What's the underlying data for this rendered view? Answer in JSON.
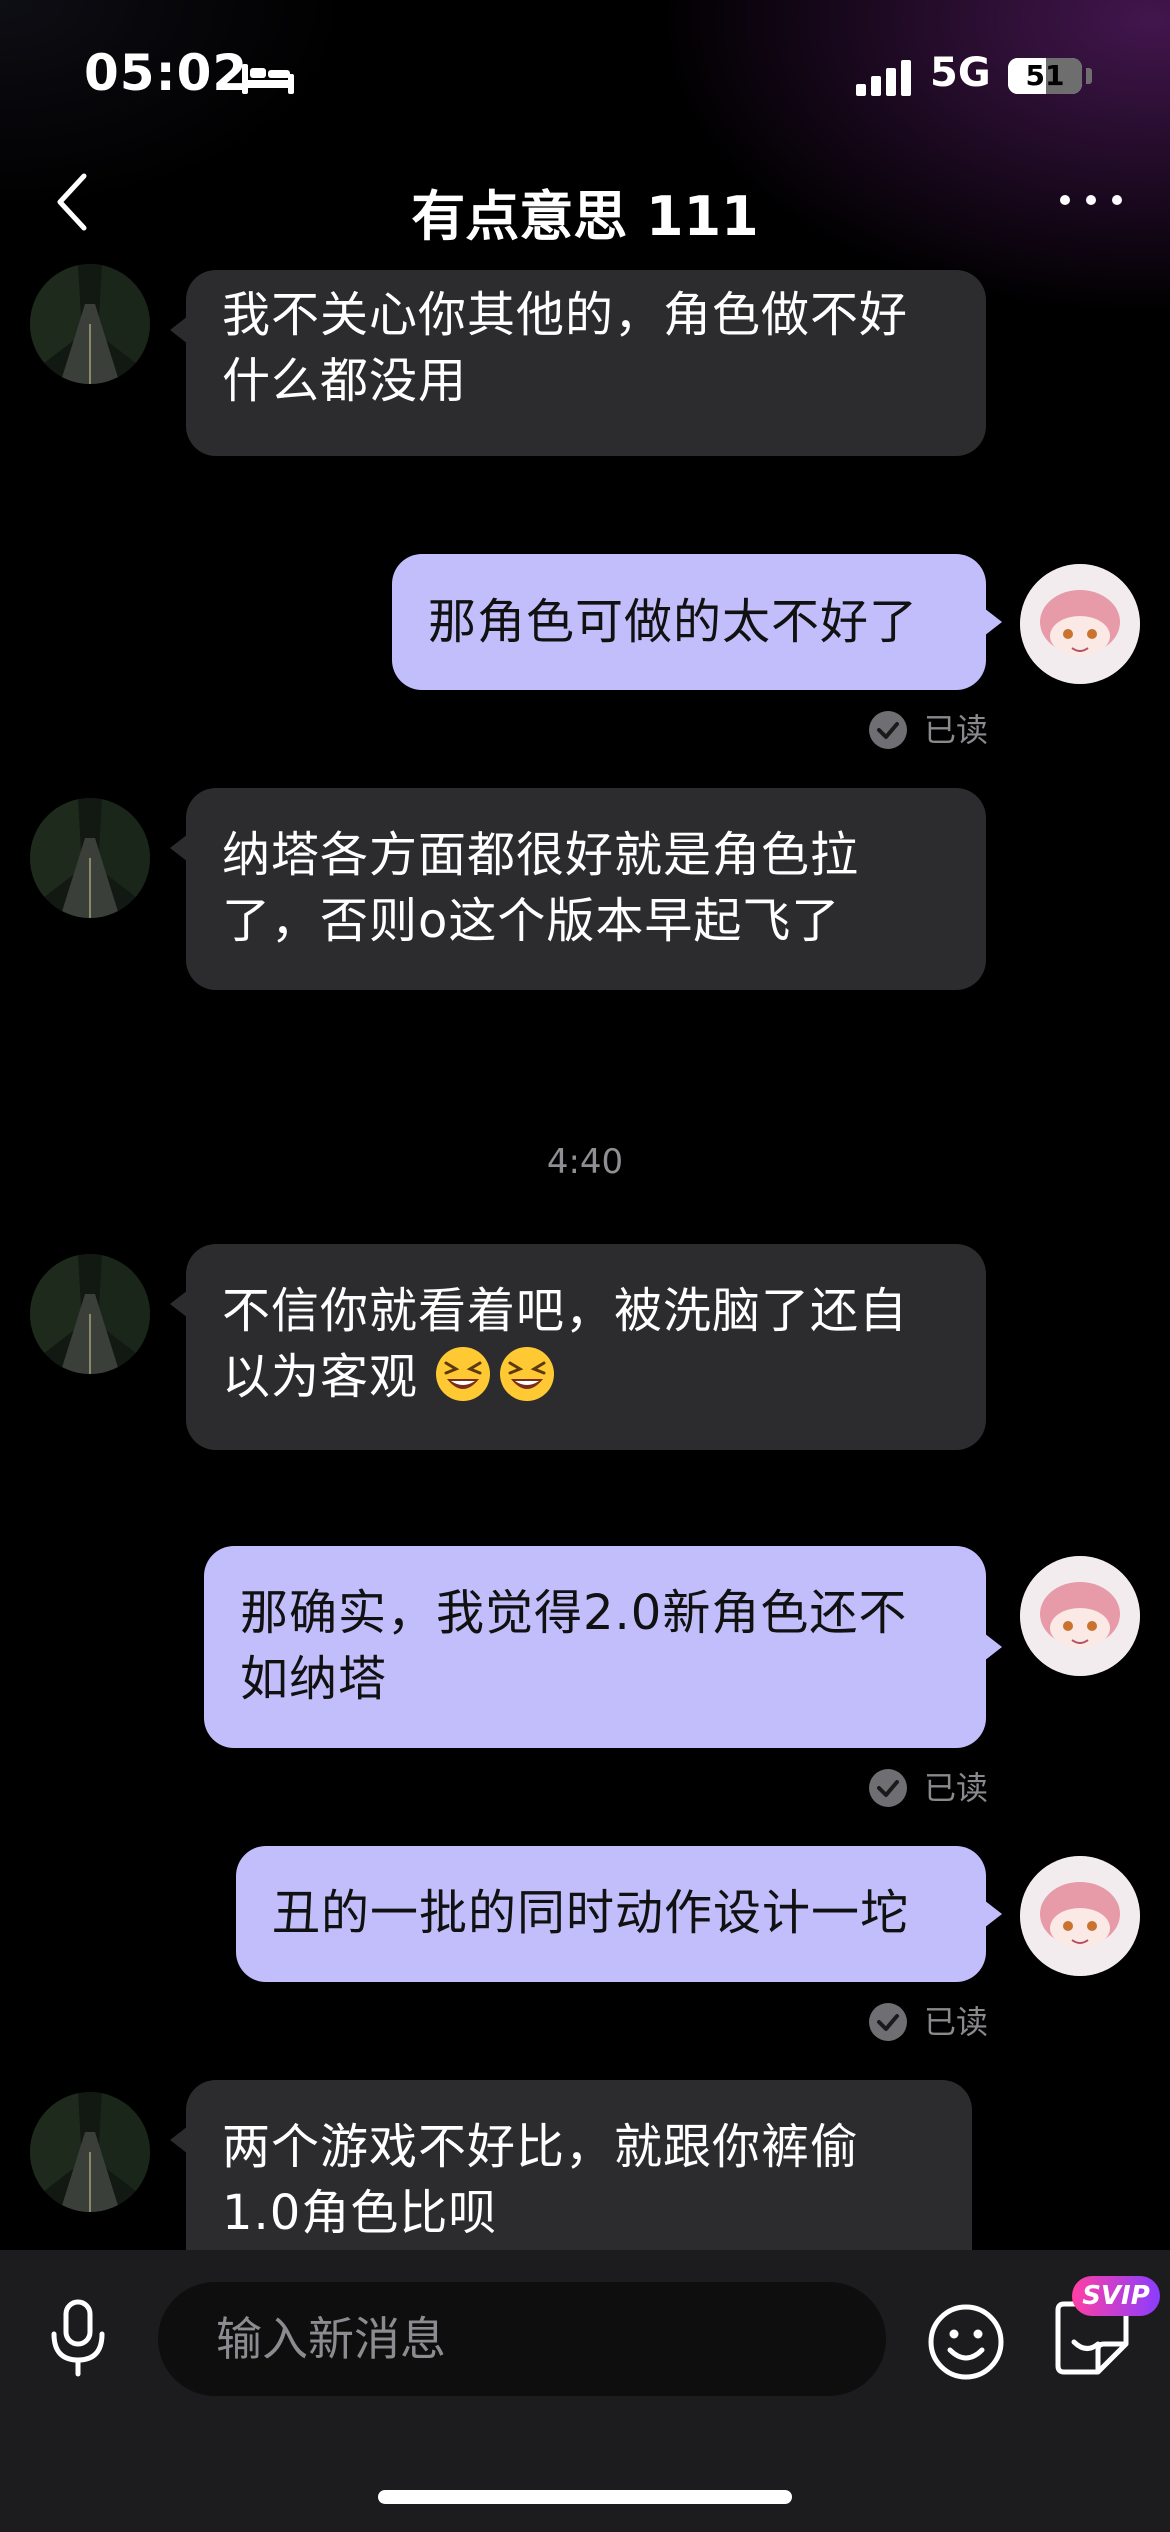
{
  "status_bar": {
    "time": "05:02",
    "network": "5G",
    "battery": "51",
    "battery_level_percent": 51,
    "icons": [
      "bed-icon",
      "signal-icon"
    ]
  },
  "header": {
    "title": "有点意思 111",
    "back_icon": "chevron-left-icon",
    "more_icon": "more-dots-icon"
  },
  "messages": [
    {
      "from": "other",
      "text": "我不关心你其他的，角色做不好什么都没用"
    },
    {
      "from": "me",
      "text": "那角色可做的太不好了",
      "status": "已读"
    },
    {
      "from": "other",
      "text": "纳塔各方面都很好就是角色拉了，否则o这个版本早起飞了"
    },
    {
      "from": "other",
      "text": "不信你就看着吧，被洗脑了还自以为客观",
      "emojis": [
        "grinning-squint-emoji",
        "grinning-squint-emoji"
      ]
    },
    {
      "from": "me",
      "text": "那确实，我觉得2.0新角色还不如纳塔",
      "status": "已读"
    },
    {
      "from": "me",
      "text": "丑的一批的同时动作设计一坨",
      "status": "已读"
    },
    {
      "from": "other",
      "text": "两个游戏不好比，就跟你裤偷1.0角色比呗"
    }
  ],
  "time_divider": "4:40",
  "input_bar": {
    "placeholder": "输入新消息",
    "badge": "SVIP",
    "icons": [
      "microphone-icon",
      "smiley-icon",
      "sticker-icon"
    ]
  },
  "colors": {
    "background": "#000000",
    "incoming_bubble": "#2c2c2e",
    "outgoing_bubble": "#c1befb",
    "read_status": "#8a8a8e",
    "svip_gradient": [
      "#ff3fa4",
      "#8a3dff"
    ]
  }
}
